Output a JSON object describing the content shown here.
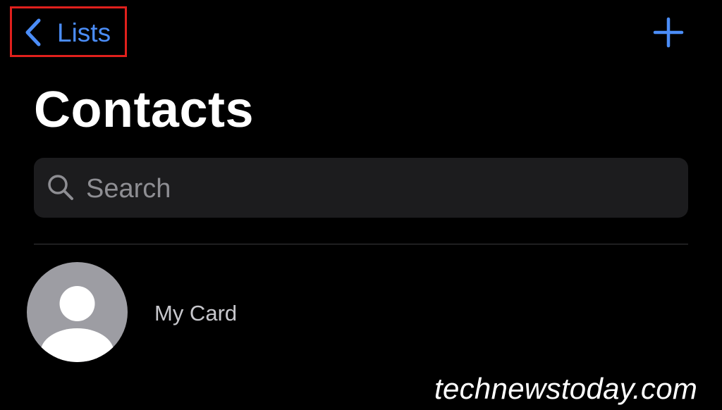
{
  "nav": {
    "back_label": "Lists",
    "back_icon": "chevron-left-icon",
    "add_icon": "plus-icon",
    "accent_color": "#4b8df8",
    "highlight_color": "#e0201c"
  },
  "header": {
    "title": "Contacts"
  },
  "search": {
    "placeholder": "Search",
    "icon": "search-icon"
  },
  "my_card": {
    "label": "My Card",
    "avatar_icon": "person-silhouette-icon"
  },
  "watermark": {
    "text": "technewstoday.com"
  }
}
